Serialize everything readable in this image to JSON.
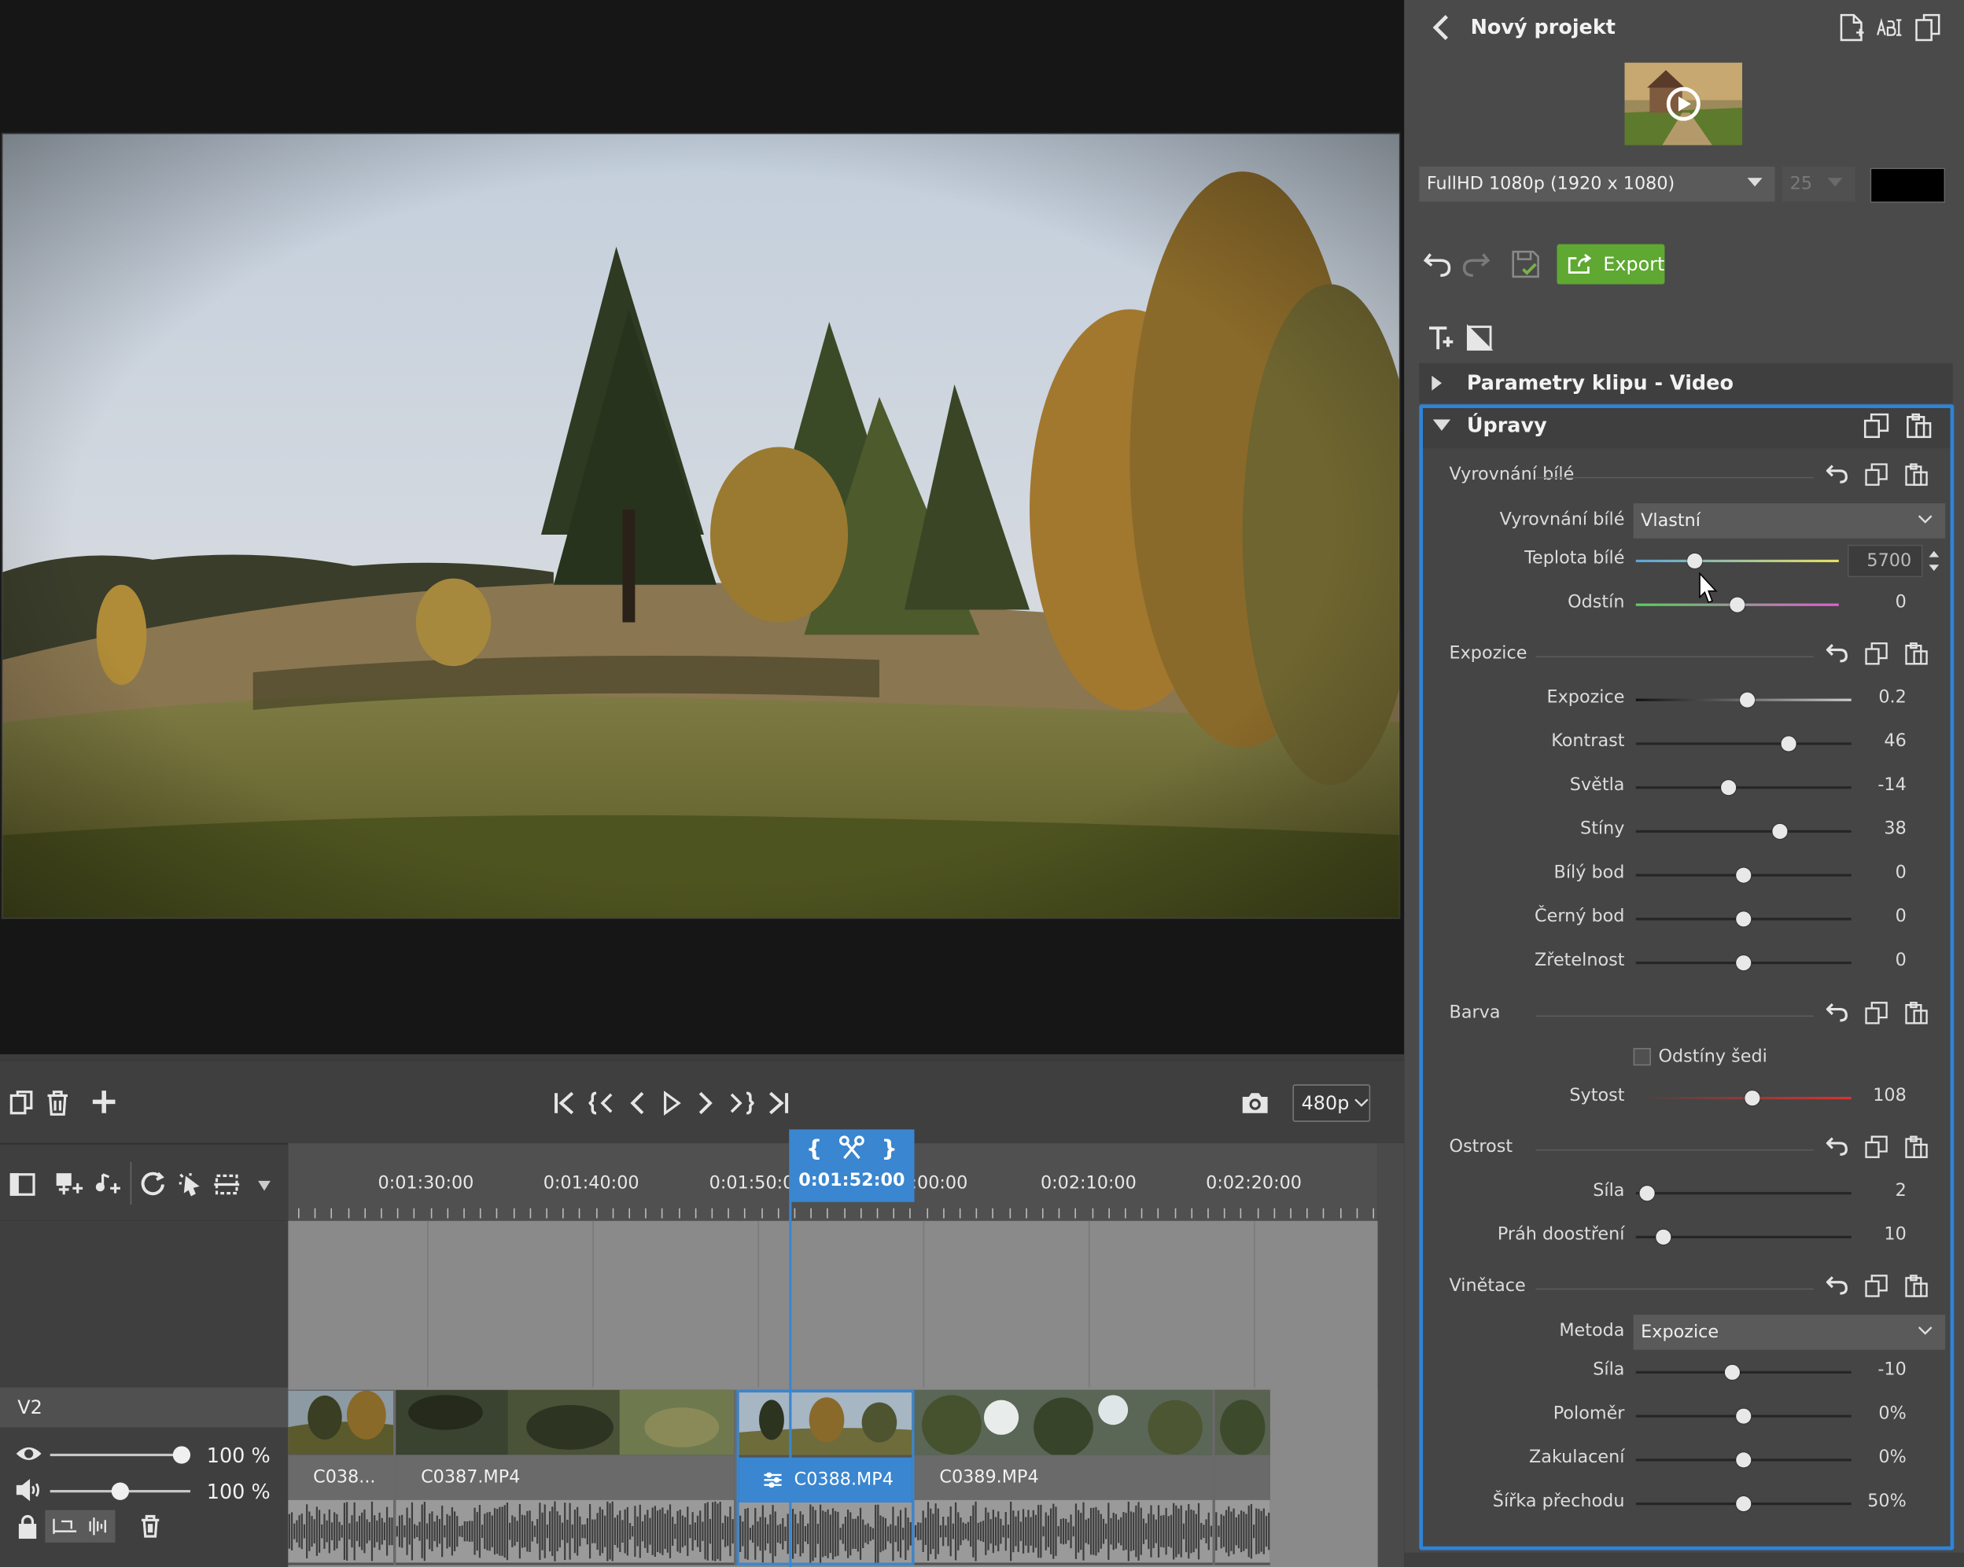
{
  "project": {
    "back_icon": "chevron-left-icon",
    "title": "Nový projekt",
    "header_icons": [
      "new-file-icon",
      "rename-icon",
      "duplicate-icon"
    ],
    "resolution": "FullHD 1080p (1920 x 1080)",
    "fps": "25",
    "bg_color": "#000000"
  },
  "toolbar": {
    "export_label": "Export",
    "export_color": "#5fa832"
  },
  "panel": {
    "clip_params": "Parametry klipu - Video",
    "upravy": "Úpravy",
    "white_balance": {
      "title": "Vyrovnání bílé",
      "mode_label": "Vyrovnání bílé",
      "mode_value": "Vlastní",
      "temp_label": "Teplota bílé",
      "temp_value": "5700",
      "temp_level": 0.29,
      "tint_label": "Odstín",
      "tint_value": "0",
      "tint_level": 0.5
    },
    "exposure": {
      "title": "Expozice",
      "sliders": [
        {
          "label": "Expozice",
          "value": "0.2",
          "level": 0.52
        },
        {
          "label": "Kontrast",
          "value": "46",
          "level": 0.71
        },
        {
          "label": "Světla",
          "value": "-14",
          "level": 0.43
        },
        {
          "label": "Stíny",
          "value": "38",
          "level": 0.67
        },
        {
          "label": "Bílý bod",
          "value": "0",
          "level": 0.5
        },
        {
          "label": "Černý bod",
          "value": "0",
          "level": 0.5
        },
        {
          "label": "Zřetelnost",
          "value": "0",
          "level": 0.5
        }
      ]
    },
    "color": {
      "title": "Barva",
      "grayscale": "Odstíny šedi",
      "sat_label": "Sytost",
      "sat_value": "108",
      "sat_level": 0.54
    },
    "sharpness": {
      "title": "Ostrost",
      "sliders": [
        {
          "label": "Síla",
          "value": "2",
          "level": 0.05
        },
        {
          "label": "Práh doostření",
          "value": "10",
          "level": 0.13
        }
      ]
    },
    "vignette": {
      "title": "Vinětace",
      "method_label": "Metoda",
      "method_value": "Expozice",
      "sliders": [
        {
          "label": "Síla",
          "value": "-10",
          "level": 0.45
        },
        {
          "label": "Poloměr",
          "value": "0%",
          "level": 0.5
        },
        {
          "label": "Zakulacení",
          "value": "0%",
          "level": 0.5
        },
        {
          "label": "Šířka přechodu",
          "value": "50%",
          "level": 0.5
        }
      ]
    }
  },
  "player": {
    "quality": "480p",
    "transport_icons": [
      "go-start-icon",
      "prev-mark-icon",
      "prev-frame-icon",
      "play-icon",
      "next-frame-icon",
      "next-mark-icon",
      "go-end-icon"
    ]
  },
  "timeline": {
    "labels": [
      "0:01:30:00",
      "0:01:40:00",
      "0:01:50:0",
      ":00:00",
      "0:02:10:00",
      "0:02:20:00"
    ],
    "playhead_time": "0:01:52:00",
    "track": {
      "name": "V2",
      "video_opacity": "100 %",
      "audio_volume": "100 %"
    },
    "clips": [
      "C038...",
      "C0387.MP4",
      "C0388.MP4",
      "C0389.MP4"
    ]
  }
}
